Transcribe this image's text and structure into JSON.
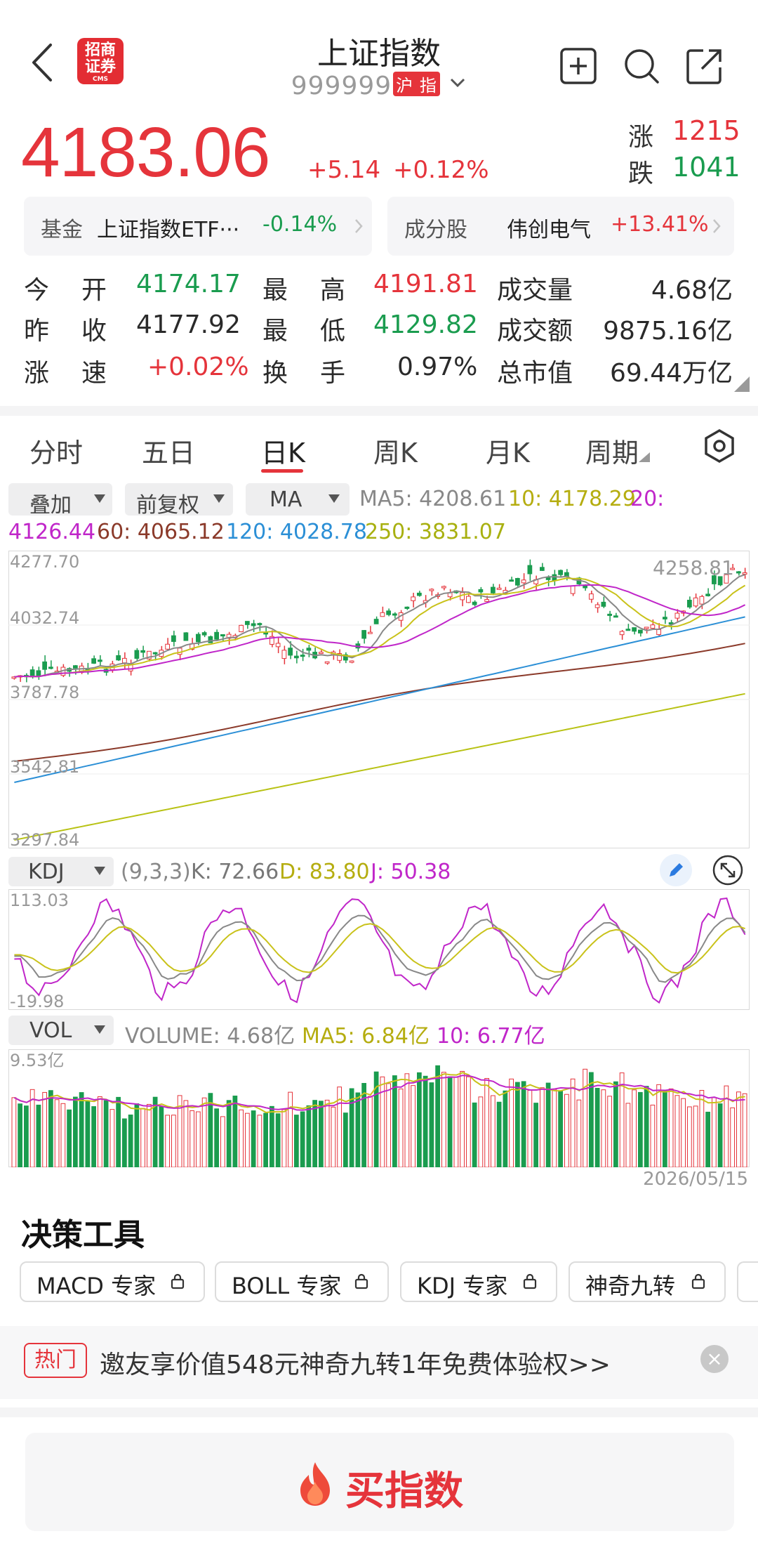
{
  "header": {
    "title": "上证指数",
    "code": "999999",
    "market_badge_1": "沪",
    "market_badge_2": "指",
    "logo_line1": "招商",
    "logo_line2": "证券",
    "logo_small": "CMS"
  },
  "quote": {
    "price": "4183.06",
    "change": "+5.14",
    "change_pct": "+0.12%",
    "up_label": "涨",
    "up_count": "1215",
    "down_label": "跌",
    "down_count": "1041"
  },
  "cards": {
    "fund_label": "基金",
    "fund_name": "上证指数ETF···",
    "fund_change": "-0.14%",
    "component_label": "成分股",
    "component_name": "伟创电气",
    "component_change": "+13.41%"
  },
  "stats": {
    "open_label_1": "今",
    "open_label_2": "开",
    "open": "4174.17",
    "high_label_1": "最",
    "high_label_2": "高",
    "high": "4191.81",
    "vol_label": "成交量",
    "vol": "4.68亿",
    "prev_label_1": "昨",
    "prev_label_2": "收",
    "prev": "4177.92",
    "low_label_1": "最",
    "low_label_2": "低",
    "low": "4129.82",
    "amt_label": "成交额",
    "amt": "9875.16亿",
    "speed_label_1": "涨",
    "speed_label_2": "速",
    "speed": "+0.02%",
    "turn_label_1": "换",
    "turn_label_2": "手",
    "turn": "0.97%",
    "mcap_label": "总市值",
    "mcap": "69.44万亿"
  },
  "tabs": [
    "分时",
    "五日",
    "日K",
    "周K",
    "月K",
    "周期"
  ],
  "active_tab": "日K",
  "kline_toolbar": {
    "overlay": "叠加",
    "adjust": "前复权",
    "indicator": "MA",
    "ma5": "MA5: 4208.61",
    "ma10": "10: 4178.29",
    "ma20": "20:",
    "ma20_val": "4126.44",
    "ma60": "60: 4065.12",
    "ma120": "120: 4028.78",
    "ma250": "250: 3831.07"
  },
  "main_chart": {
    "y_labels": [
      "4277.70",
      "4032.74",
      "3787.78",
      "3542.81",
      "3297.84"
    ],
    "high_marker": "4258.81"
  },
  "kdj": {
    "name": "KDJ",
    "params": "(9,3,3)",
    "k": "K: 72.66",
    "d": "D: 83.80",
    "j": "J: 50.38",
    "y_max": "113.03",
    "y_min": "-19.98"
  },
  "volume": {
    "name": "VOL",
    "vol": "VOLUME: 4.68亿",
    "ma5": "MA5: 6.84亿",
    "ma10": "10: 6.77亿",
    "y_max": "9.53亿",
    "end_date": "2026/05/15"
  },
  "tools": {
    "title": "决策工具",
    "items": [
      "MACD 专家",
      "BOLL 专家",
      "KDJ 专家",
      "神奇九转"
    ]
  },
  "promo": {
    "badge": "热门",
    "text": "邀友享价值548元神奇九转1年免费体验权>>"
  },
  "buy": {
    "label": "买指数"
  },
  "colors": {
    "up": "#e5343b",
    "down": "#1a9c4f",
    "ma5": "#888888",
    "ma10": "#c9c21a",
    "ma20": "#c026c9",
    "ma60": "#8b3a2a",
    "ma120": "#2b8fd6",
    "ma250": "#b8c214"
  },
  "chart_data": {
    "type": "candlestick",
    "series_lines": [
      "MA5",
      "MA10",
      "MA20",
      "MA60",
      "MA120",
      "MA250"
    ],
    "ylim": [
      3297.84,
      4277.7
    ],
    "last_close": 4183.06
  }
}
